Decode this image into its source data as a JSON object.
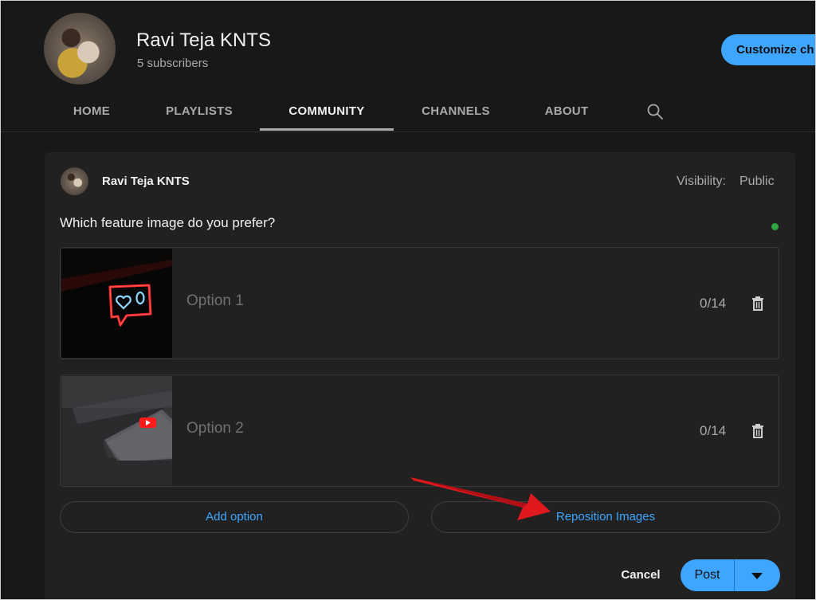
{
  "channel": {
    "name": "Ravi Teja KNTS",
    "subscribers": "5 subscribers",
    "customize_label": "Customize ch"
  },
  "tabs": [
    {
      "label": "HOME"
    },
    {
      "label": "PLAYLISTS"
    },
    {
      "label": "COMMUNITY"
    },
    {
      "label": "CHANNELS"
    },
    {
      "label": "ABOUT"
    }
  ],
  "active_tab": "COMMUNITY",
  "composer": {
    "author": "Ravi Teja KNTS",
    "visibility_label": "Visibility:",
    "visibility_value": "Public",
    "question": "Which feature image do you prefer?",
    "options": [
      {
        "placeholder": "Option 1",
        "count": "0/14",
        "image": "neon-heart-notification-sign"
      },
      {
        "placeholder": "Option 2",
        "count": "0/14",
        "image": "phone-with-youtube-logo-on-keyboard"
      }
    ],
    "add_option_label": "Add option",
    "reposition_label": "Reposition Images",
    "cancel_label": "Cancel",
    "post_label": "Post"
  },
  "colors": {
    "background": "#181818",
    "card": "#212121",
    "accent": "#3ea6ff",
    "annotation_arrow": "#e0191e",
    "status_dot": "#2ba640"
  },
  "icons": [
    "search-icon",
    "trash-icon",
    "caret-down-icon"
  ]
}
